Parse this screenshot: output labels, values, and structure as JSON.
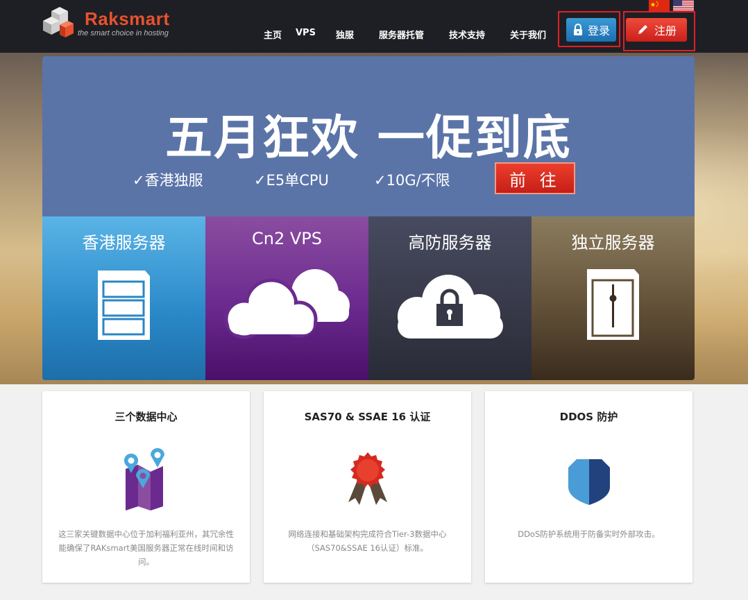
{
  "brand": {
    "name": "Raksmart",
    "tagline": "the smart choice in hosting"
  },
  "nav": {
    "items": [
      "主页",
      "VPS",
      "独服",
      "服务器托管",
      "技术支持",
      "关于我们"
    ]
  },
  "auth": {
    "login_label": "登录",
    "register_label": "注册"
  },
  "languages": [
    "china-flag-icon",
    "usa-flag-icon"
  ],
  "promo": {
    "title": "五月狂欢 一促到底",
    "features": [
      "✓香港独服",
      "✓E5单CPU",
      "✓10G/不限"
    ],
    "cta_label": "前 往"
  },
  "categories": [
    {
      "label": "香港服务器",
      "icon": "server-icon"
    },
    {
      "label": "Cn2 VPS",
      "icon": "cloud-icon"
    },
    {
      "label": "高防服务器",
      "icon": "cloud-lock-icon"
    },
    {
      "label": "独立服务器",
      "icon": "dedicated-server-icon"
    }
  ],
  "cards": [
    {
      "title": "三个数据中心",
      "icon": "map-pin-icon",
      "text": "这三家关键数据中心位于加利福利亚州，其冗余性能确保了RAKsmart美国服务器正常在线时间和访问。"
    },
    {
      "title": "SAS70 & SSAE 16 认证",
      "icon": "award-ribbon-icon",
      "text": "网络连接和基础架构完成符合Tier-3数据中心（SAS70&SSAE 16认证）标准。"
    },
    {
      "title": "DDOS 防护",
      "icon": "shield-icon",
      "text": "DDoS防护系统用于防备实时外部攻击。"
    }
  ],
  "colors": {
    "header_bg": "#1e1f24",
    "promo_bg": "#5b74a8",
    "brand_orange": "#e8522e",
    "cta_red": "#d42a20",
    "login_blue": "#2a84c4",
    "highlight_red": "#e0202a"
  }
}
